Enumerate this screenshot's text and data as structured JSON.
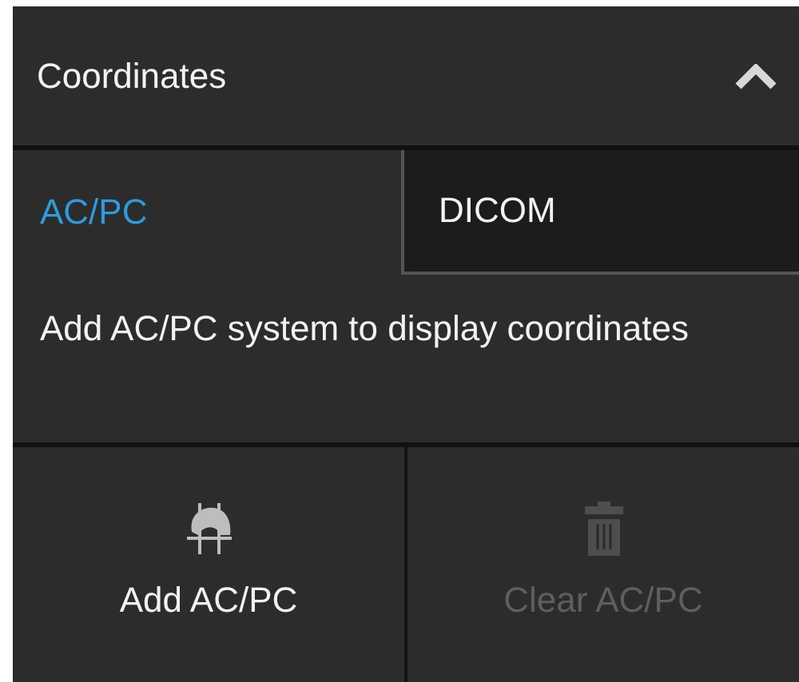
{
  "panel": {
    "title": "Coordinates",
    "expanded": true
  },
  "tabs": [
    {
      "label": "AC/PC",
      "selected": true
    },
    {
      "label": "DICOM",
      "selected": false
    }
  ],
  "message": "Add AC/PC system to display coordinates",
  "actions": [
    {
      "kind": "add",
      "label": "Add AC/PC",
      "disabled": false
    },
    {
      "kind": "clear",
      "label": "Clear AC/PC",
      "disabled": true
    }
  ]
}
